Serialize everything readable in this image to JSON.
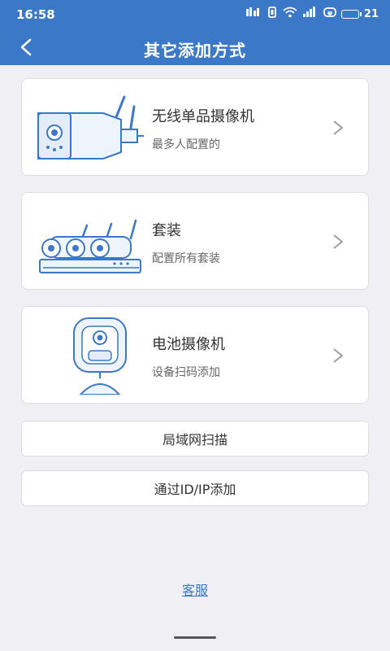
{
  "status_bar": {
    "time": "16:58",
    "battery": "21",
    "network_text": "hd"
  },
  "app_bar": {
    "title": "其它添加方式"
  },
  "cards": [
    {
      "title": "无线单品摄像机",
      "subtitle": "最多人配置的",
      "icon": "bullet-camera-illustration"
    },
    {
      "title": "套装",
      "subtitle": "配置所有套装",
      "icon": "nvr-kit-illustration"
    },
    {
      "title": "电池摄像机",
      "subtitle": "设备扫码添加",
      "icon": "battery-camera-illustration"
    }
  ],
  "buttons": {
    "lan_scan": "局域网扫描",
    "add_by_id_ip": "通过ID/IP添加"
  },
  "footer": {
    "customer_service": "客服"
  },
  "colors": {
    "accent": "#3c78c8",
    "background": "#efeff4",
    "card": "#ffffff"
  }
}
